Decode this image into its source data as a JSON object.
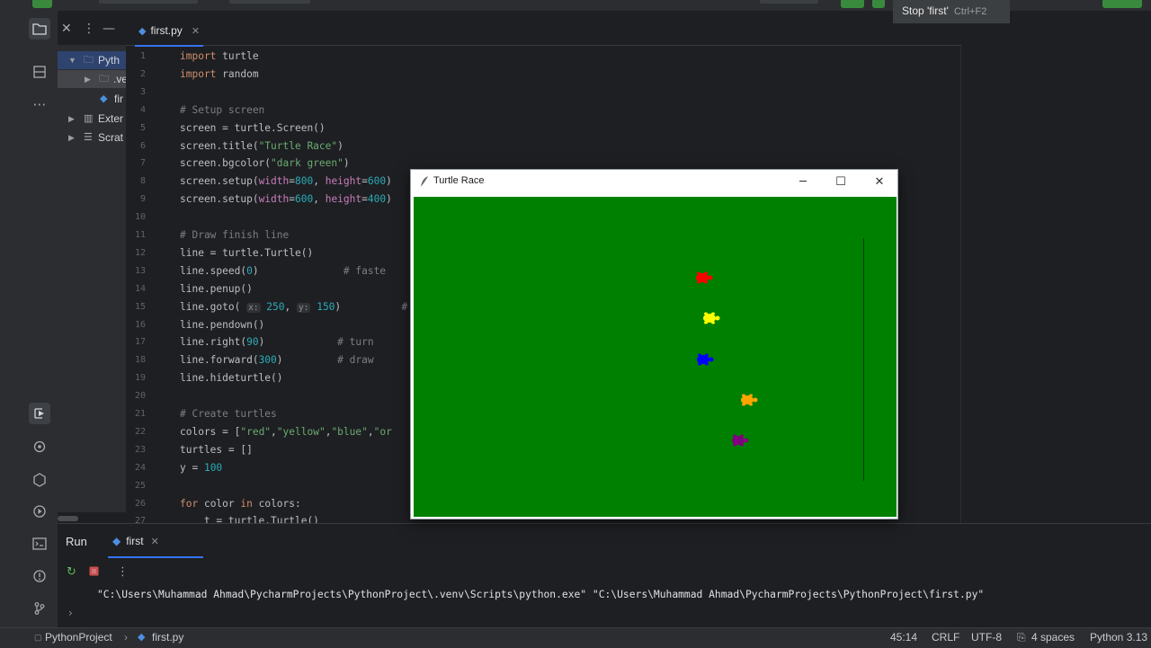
{
  "ide": {
    "stop_tooltip": {
      "label": "Stop 'first'",
      "shortcut": "Ctrl+F2"
    },
    "project_tree": [
      {
        "label": "Pyth",
        "icon": "folder-icon",
        "expanded": true
      },
      {
        "label": ".ve",
        "icon": "folder-icon",
        "expanded": false
      },
      {
        "label": "fir",
        "icon": "python-file-icon"
      },
      {
        "label": "Exter",
        "icon": "library-icon",
        "expanded": false
      },
      {
        "label": "Scrat",
        "icon": "scratch-icon",
        "expanded": false
      }
    ],
    "editor_tab": {
      "label": "first.py"
    },
    "code_lines": [
      {
        "n": "1",
        "html": "<span class=\"kw\">import</span> turtle"
      },
      {
        "n": "2",
        "html": "<span class=\"kw\">import</span> random"
      },
      {
        "n": "3",
        "html": ""
      },
      {
        "n": "4",
        "html": "<span class=\"cmt\"># Setup screen</span>"
      },
      {
        "n": "5",
        "html": "screen = turtle.Screen()"
      },
      {
        "n": "6",
        "html": "screen.title(<span class=\"str\">\"Turtle Race\"</span>)"
      },
      {
        "n": "7",
        "html": "screen.bgcolor(<span class=\"str\">\"dark green\"</span>)"
      },
      {
        "n": "8",
        "html": "screen.setup(<span class=\"param\">width</span>=<span class=\"num\">800</span>, <span class=\"param\">height</span>=<span class=\"num\">600</span>)"
      },
      {
        "n": "9",
        "html": "screen.setup(<span class=\"param\">width</span>=<span class=\"num\">600</span>, <span class=\"param\">height</span>=<span class=\"num\">400</span>)"
      },
      {
        "n": "10",
        "html": ""
      },
      {
        "n": "11",
        "html": "<span class=\"cmt\"># Draw finish line</span>"
      },
      {
        "n": "12",
        "html": "line = turtle.Turtle()"
      },
      {
        "n": "13",
        "html": "line.speed(<span class=\"num\">0</span>)              <span class=\"cmt\"># faste</span>"
      },
      {
        "n": "14",
        "html": "line.penup()"
      },
      {
        "n": "15",
        "html": "line.goto( <span class=\"hint\">x:</span> <span class=\"num\">250</span>, <span class=\"hint\">y:</span> <span class=\"num\">150</span>)          <span class=\"cmt\">#</span>"
      },
      {
        "n": "16",
        "html": "line.pendown()"
      },
      {
        "n": "17",
        "html": "line.right(<span class=\"num\">90</span>)            <span class=\"cmt\"># turn</span>"
      },
      {
        "n": "18",
        "html": "line.forward(<span class=\"num\">300</span>)         <span class=\"cmt\"># draw</span>"
      },
      {
        "n": "19",
        "html": "line.hideturtle()"
      },
      {
        "n": "20",
        "html": ""
      },
      {
        "n": "21",
        "html": "<span class=\"cmt\"># Create turtles</span>"
      },
      {
        "n": "22",
        "html": "colors = [<span class=\"str\">\"red\"</span>,<span class=\"str\">\"yellow\"</span>,<span class=\"str\">\"blue\"</span>,<span class=\"str\">\"or</span>"
      },
      {
        "n": "23",
        "html": "turtles = []"
      },
      {
        "n": "24",
        "html": "y = <span class=\"num\">100</span>"
      },
      {
        "n": "25",
        "html": ""
      },
      {
        "n": "26",
        "html": "<span class=\"kw\">for</span> color <span class=\"kw\">in</span> colors:"
      },
      {
        "n": "27",
        "html": "    t = turtle.Turtle()"
      }
    ],
    "run": {
      "header": "Run",
      "tab_label": "first",
      "command": "\"C:\\Users\\Muhammad Ahmad\\PycharmProjects\\PythonProject\\.venv\\Scripts\\python.exe\" \"C:\\Users\\Muhammad Ahmad\\PycharmProjects\\PythonProject\\first.py\""
    },
    "status": {
      "project": "PythonProject",
      "file": "first.py",
      "position": "45:14",
      "line_sep": "CRLF",
      "encoding": "UTF-8",
      "indent": "4 spaces",
      "interpreter": "Python 3.13"
    }
  },
  "turtle_window": {
    "title": "Turtle Race",
    "canvas_color": "#008000",
    "turtles": [
      {
        "color": "#ff0000",
        "name": "red"
      },
      {
        "color": "#ffff00",
        "name": "yellow"
      },
      {
        "color": "#0000ff",
        "name": "blue"
      },
      {
        "color": "#ffa500",
        "name": "orange"
      },
      {
        "color": "#800080",
        "name": "purple"
      }
    ]
  }
}
